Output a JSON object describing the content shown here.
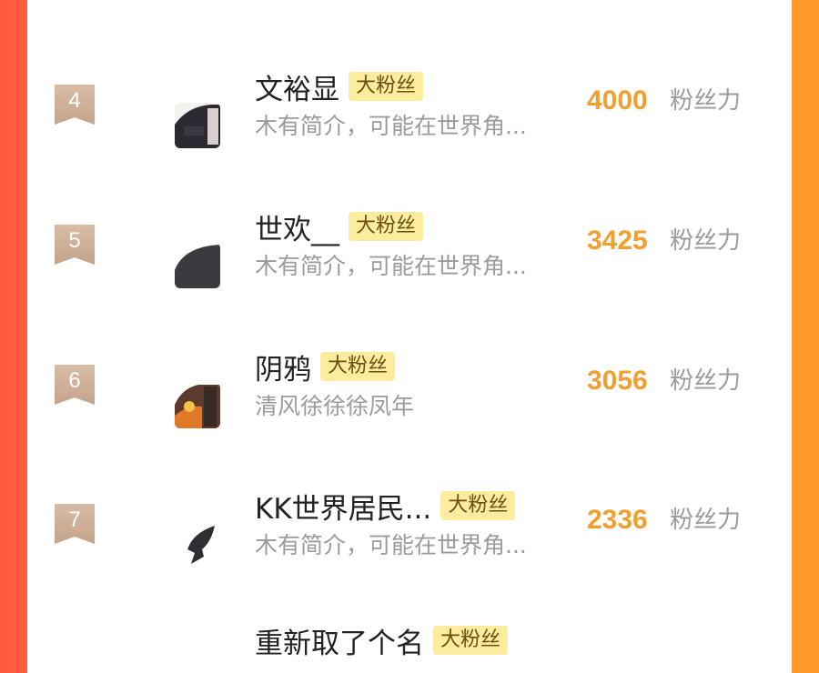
{
  "list": {
    "rows": [
      {
        "rank": "4",
        "name": "文裕显",
        "badge": "大粉丝",
        "bio": "木有简介，可能在世界角...",
        "score": "4000",
        "score_unit": "粉丝力"
      },
      {
        "rank": "5",
        "name": "世欢__",
        "badge": "大粉丝",
        "bio": "木有简介，可能在世界角...",
        "score": "3425",
        "score_unit": "粉丝力"
      },
      {
        "rank": "6",
        "name": "阴鸦",
        "badge": "大粉丝",
        "bio": "清风徐徐徐凤年",
        "score": "3056",
        "score_unit": "粉丝力"
      },
      {
        "rank": "7",
        "name": "KK世界居民...",
        "badge": "大粉丝",
        "bio": "木有简介，可能在世界角...",
        "score": "2336",
        "score_unit": "粉丝力"
      }
    ],
    "peek_row": {
      "name": "重新取了个名",
      "badge": "大粉丝"
    }
  },
  "colors": {
    "score": "#f0a030",
    "badge_bg": "#fcec9d",
    "rank_badge": "#c4a48b",
    "accent_left": "#ff5a3c",
    "accent_right": "#ff9a2a"
  }
}
